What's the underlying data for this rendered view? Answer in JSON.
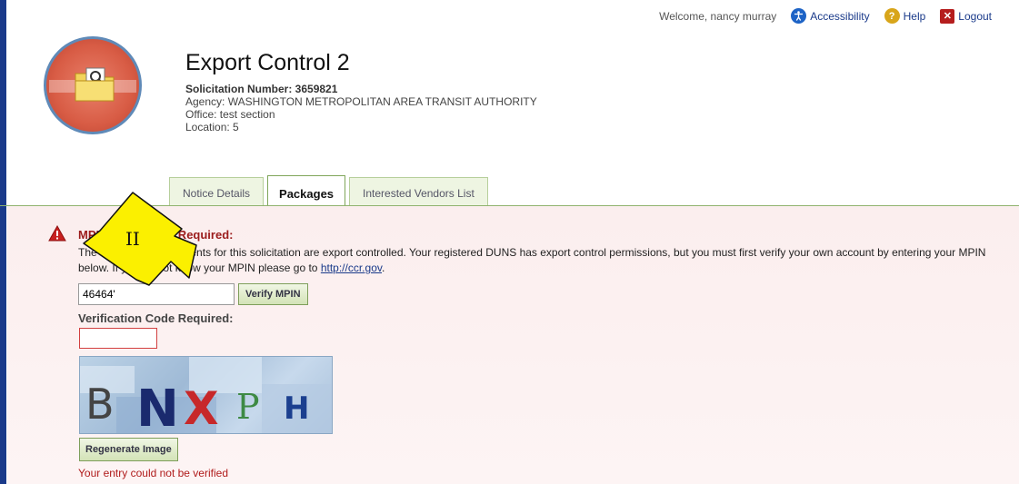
{
  "topbar": {
    "welcome": "Welcome, nancy murray",
    "accessibility_label": "Accessibility",
    "help_label": "Help",
    "logout_label": "Logout",
    "accessibility_icon": "accessibility-icon",
    "help_icon": "help-icon",
    "logout_icon": "logout-icon"
  },
  "header": {
    "title": "Export Control 2",
    "solicitation": "Solicitation Number: 3659821",
    "agency": "Agency: WASHINGTON METROPOLITAN AREA TRANSIT AUTHORITY",
    "office": "Office: test section",
    "location": "Location: 5"
  },
  "tabs": [
    {
      "label": "Notice Details",
      "active": false
    },
    {
      "label": "Packages",
      "active": true
    },
    {
      "label": "Interested Vendors List",
      "active": false
    }
  ],
  "notice": {
    "title": "MPIN Verification Required:",
    "message_before_link": "The Solicitation Documents for this solicitation are export controlled. Your registered DUNS has export control permissions, but you must first verify your own account by entering your MPIN below. If you do not know your MPIN please go to ",
    "link_text": "http://ccr.gov",
    "message_after_link": "."
  },
  "form": {
    "mpin_value": "46464'",
    "verify_label": "Verify MPIN",
    "verification_label": "Verification Code Required:",
    "verification_value": "",
    "captcha_text": "BNXPH",
    "regenerate_label": "Regenerate Image",
    "error_text": "Your entry could not be verified"
  },
  "annotation": {
    "label": "II"
  },
  "colors": {
    "accent": "#1a3a8a",
    "error": "#b01b1b",
    "tab_border": "#8fb36e",
    "panel_bg": "#fbeeee"
  }
}
